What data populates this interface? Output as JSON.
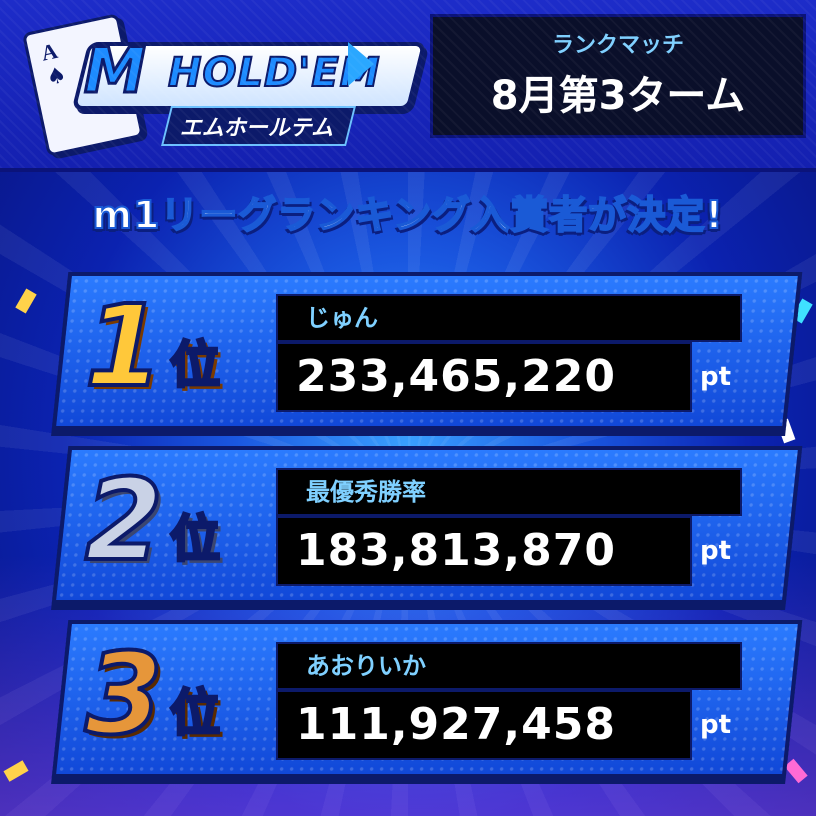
{
  "header": {
    "logo": {
      "card_rank": "A",
      "card_suit": "♠",
      "wordmark_m": "M",
      "wordmark_text": "HOLD'EM",
      "subtitle": "エムホールテム"
    },
    "term": {
      "subtitle": "ランクマッチ",
      "title": "8月第3ターム"
    }
  },
  "headline": "m1リーグランキング入賞者が決定!",
  "rankings": [
    {
      "rank": "1",
      "rank_suffix": "位",
      "name": "じゅん",
      "score": "233,465,220",
      "unit": "pt",
      "medal": "gold"
    },
    {
      "rank": "2",
      "rank_suffix": "位",
      "name": "最優秀勝率",
      "score": "183,813,870",
      "unit": "pt",
      "medal": "silver"
    },
    {
      "rank": "3",
      "rank_suffix": "位",
      "name": "あおりいか",
      "score": "111,927,458",
      "unit": "pt",
      "medal": "bronze"
    }
  ],
  "colors": {
    "accent": "#1d8bff",
    "gold": "#ffc83a",
    "silver": "#c9d2e6",
    "bronze": "#e6963a",
    "name_text": "#7fd0ff"
  }
}
